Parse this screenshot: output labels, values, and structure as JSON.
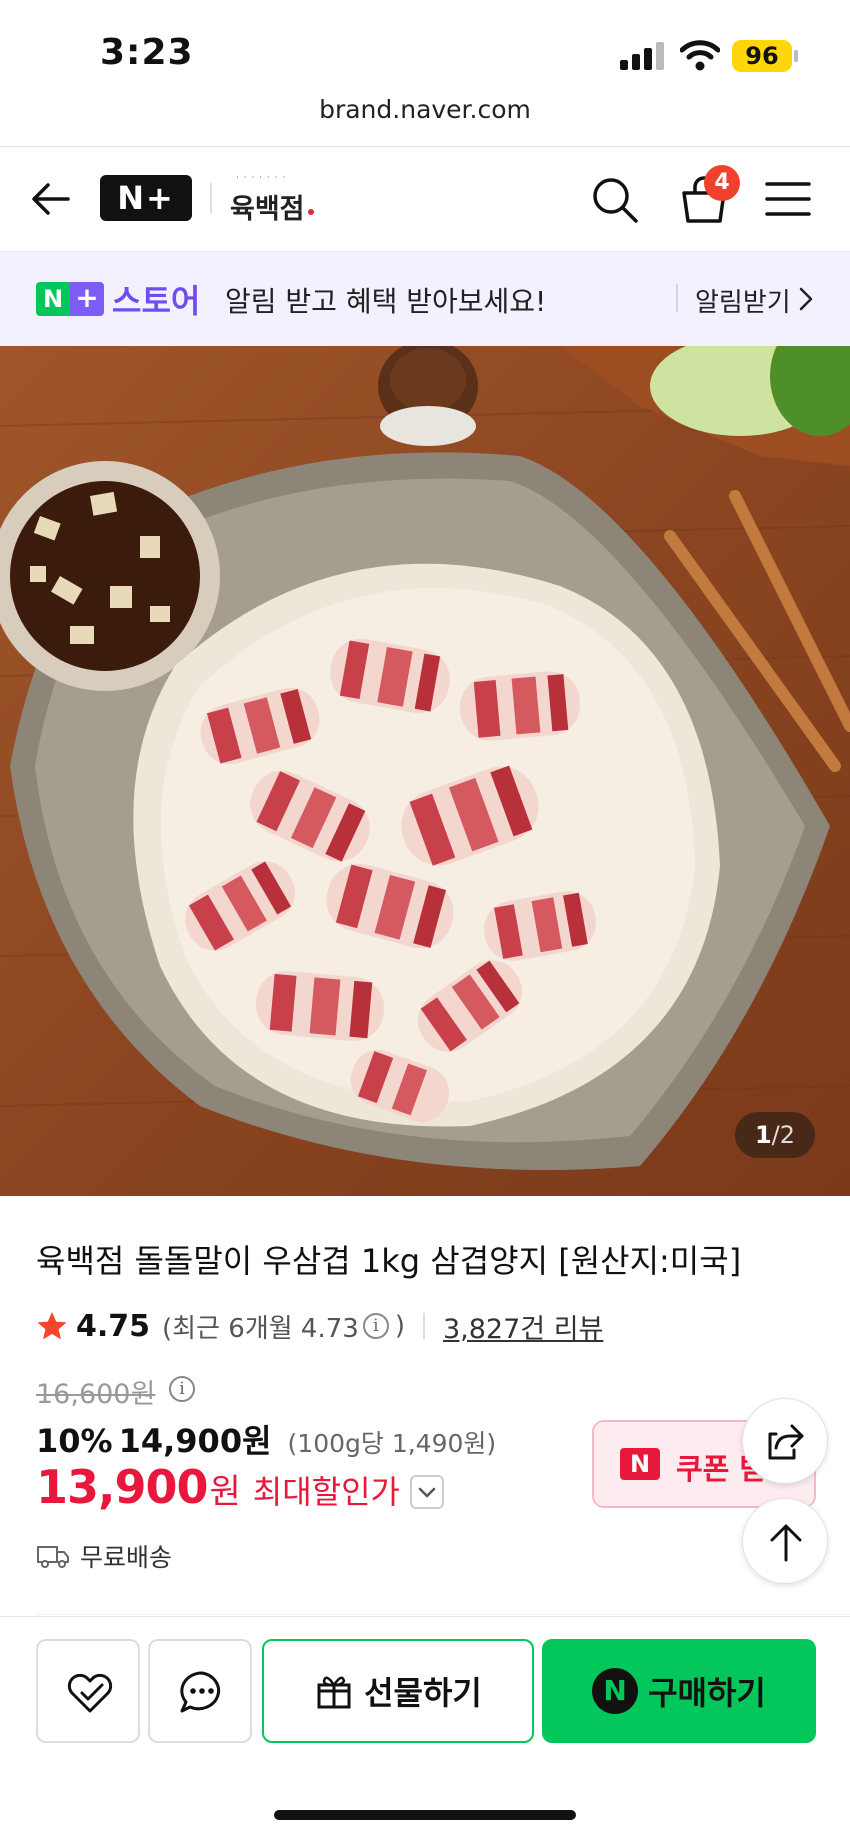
{
  "status": {
    "time": "3:23",
    "battery": "96"
  },
  "browser": {
    "url": "brand.naver.com"
  },
  "header": {
    "np_logo": "N+",
    "brand_logo": "육백점",
    "cart_count": "4"
  },
  "promo": {
    "store_n": "N",
    "store_plus": "+",
    "store_label": "스토어",
    "text": "알림 받고 혜택 받아보세요!",
    "cta": "알림받기"
  },
  "gallery": {
    "current": "1",
    "separator": "/",
    "total": "2"
  },
  "product": {
    "title": "육백점 돌돌말이 우삼겹 1kg 삼겹양지 [원산지:미국]",
    "rating": "4.75",
    "recent_open": "(최근 6개월 4.73",
    "recent_close": ")",
    "reviews": "3,827건 리뷰",
    "original_price": "16,600원",
    "discount_pct": "10%",
    "sale_price": "14,900원",
    "unit_price": "(100g당 1,490원)",
    "max_price": "13,900",
    "max_won": "원",
    "max_label": "최대할인가",
    "shipping": "무료배송"
  },
  "coupon": {
    "badge": "N",
    "label": "쿠폰 받"
  },
  "bottom": {
    "gift_label": "선물하기",
    "buy_badge": "N",
    "buy_label": "구매하기"
  },
  "colors": {
    "naver_green": "#03c75a",
    "sale_red": "#e8183c",
    "purple": "#6f4cf0",
    "badge_orange": "#f0412d"
  }
}
